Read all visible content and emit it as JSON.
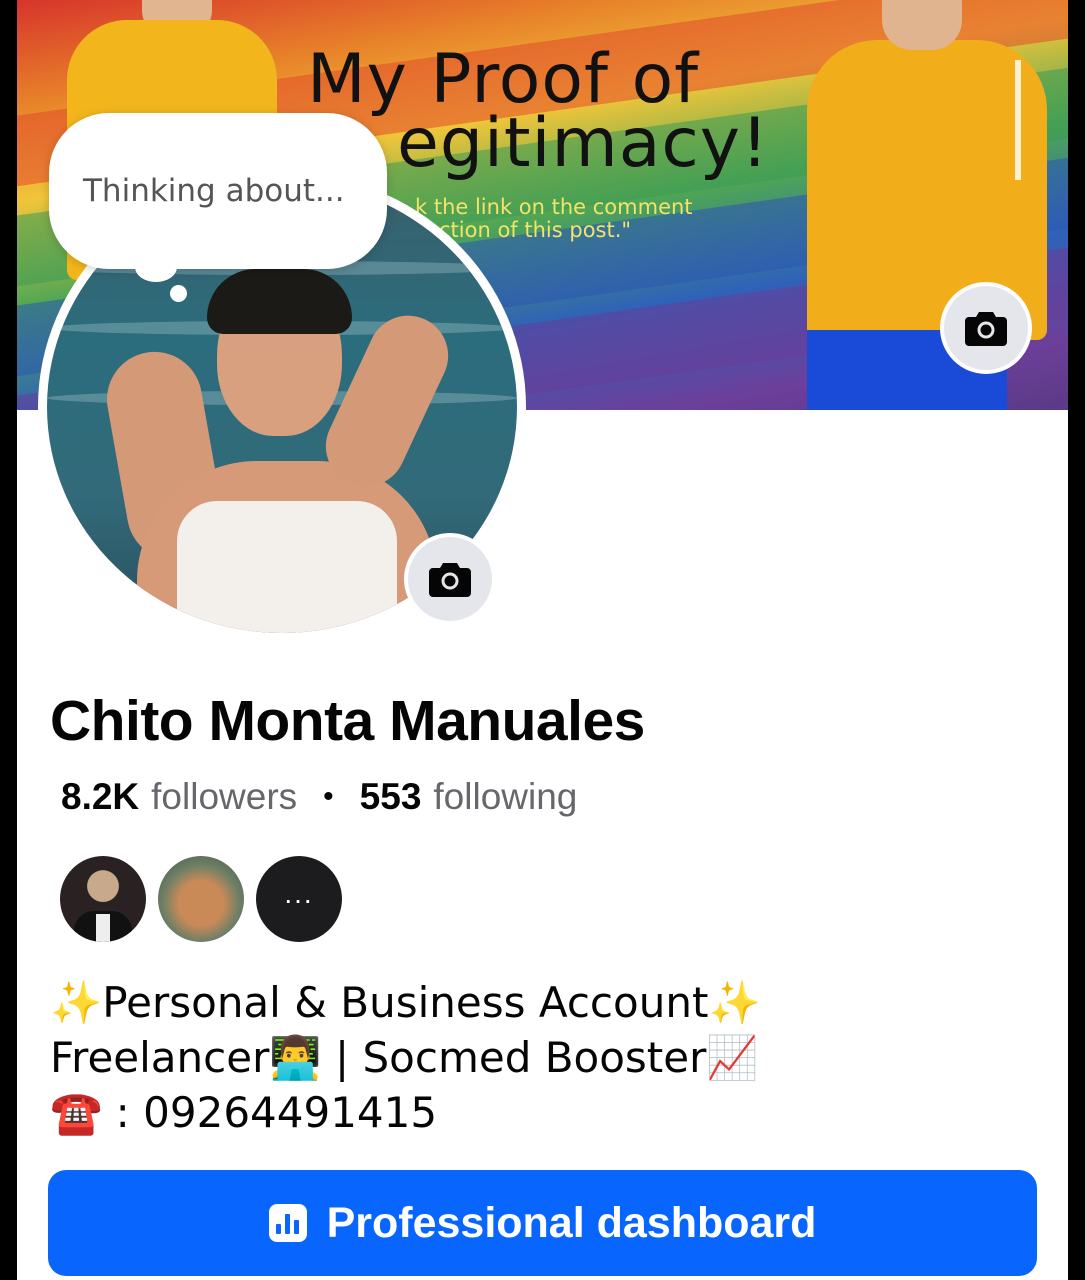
{
  "cover": {
    "title_line1": "My Proof of",
    "title_line2": "egitimacy!",
    "sub_line1": "k the link on the comment",
    "sub_line2": "ction of this post.\""
  },
  "thought_bubble": {
    "placeholder": "Thinking about..."
  },
  "profile": {
    "name": "Chito Monta Manuales",
    "followers_count": "8.2K",
    "followers_label": "followers",
    "separator": "•",
    "following_count": "553",
    "following_label": "following"
  },
  "friends": {
    "more_label": "..."
  },
  "bio": {
    "line1_emoji_a": "✨",
    "line1_text": "Personal & Business Account",
    "line1_emoji_b": "✨",
    "line2_text": "Freelancer",
    "line2_emoji_a": "👨‍💻",
    "line2_mid": " | Socmed Booster",
    "line2_emoji_b": "📈",
    "line3_emoji": "☎️",
    "line3_text": " : 09264491415"
  },
  "actions": {
    "dashboard_label": "Professional dashboard"
  },
  "icons": {
    "camera_cover": "camera-icon",
    "camera_profile": "camera-icon",
    "dashboard": "bar-chart-icon"
  },
  "colors": {
    "accent": "#0866ff",
    "name_text": "#050505",
    "secondary_text": "#65676b"
  }
}
